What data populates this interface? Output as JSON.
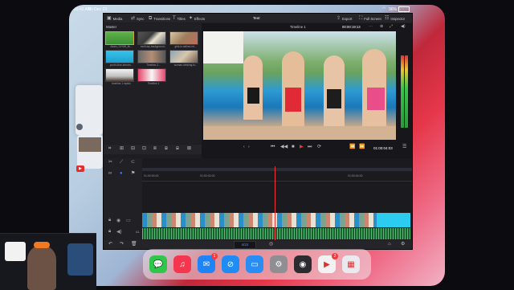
{
  "status": {
    "time": "10:43 AM",
    "date": "Fri Dec 23",
    "battery": "96%"
  },
  "toolbar": {
    "media": "Media",
    "sync": "Sync",
    "transitions": "Transitions",
    "titles": "Titles",
    "effects": "Effects",
    "project": "Test",
    "export": "Export",
    "fullscreen": "Full Screen",
    "inspector": "Inspector"
  },
  "media_pool": {
    "header": "Master",
    "items": [
      {
        "label": "Adam_GrYtW_fix..."
      },
      {
        "label": "multi-lap-background..."
      },
      {
        "label": "girls-in-strikes-hd..."
      },
      {
        "label": "youth-blue-stream..."
      },
      {
        "label": "Timeline-2..."
      },
      {
        "label": "woman-drinking-tv..."
      },
      {
        "label": "timeline-1.mpsto"
      },
      {
        "label": "Timeline 1"
      }
    ]
  },
  "viewer": {
    "title": "Timeline 1",
    "timecode_top": "00:00:19:13",
    "timecode": "01:00:04:03"
  },
  "timeline": {
    "ticks": [
      "01:00:00:00",
      "01:00:02:00",
      "01:00:04:00"
    ],
    "track_v": "V1",
    "track_a": "A1"
  },
  "bottom_bar": {
    "zoom": "4/22"
  },
  "dock": {
    "apps": [
      {
        "icon": "messages-icon",
        "glyph": "💬",
        "color": "#2ec74a"
      },
      {
        "icon": "music-icon",
        "glyph": "♫",
        "color": "#f5364f"
      },
      {
        "icon": "mail-icon",
        "glyph": "✉",
        "color": "#1e84f7",
        "badge": "1"
      },
      {
        "icon": "safari-icon",
        "glyph": "⊘",
        "color": "#1f8cf5"
      },
      {
        "icon": "files-icon",
        "glyph": "▭",
        "color": "#2a8df6"
      },
      {
        "icon": "settings-icon",
        "glyph": "⚙",
        "color": "#8e8e93"
      },
      {
        "icon": "davinci-resolve-icon",
        "glyph": "◉",
        "color": "#2b2b30"
      },
      {
        "icon": "youtube-icon",
        "glyph": "▶",
        "color": "#f2f2f2",
        "badge": "2"
      },
      {
        "icon": "app-library-icon",
        "glyph": "▦",
        "color": "#e9e9ee"
      }
    ]
  }
}
